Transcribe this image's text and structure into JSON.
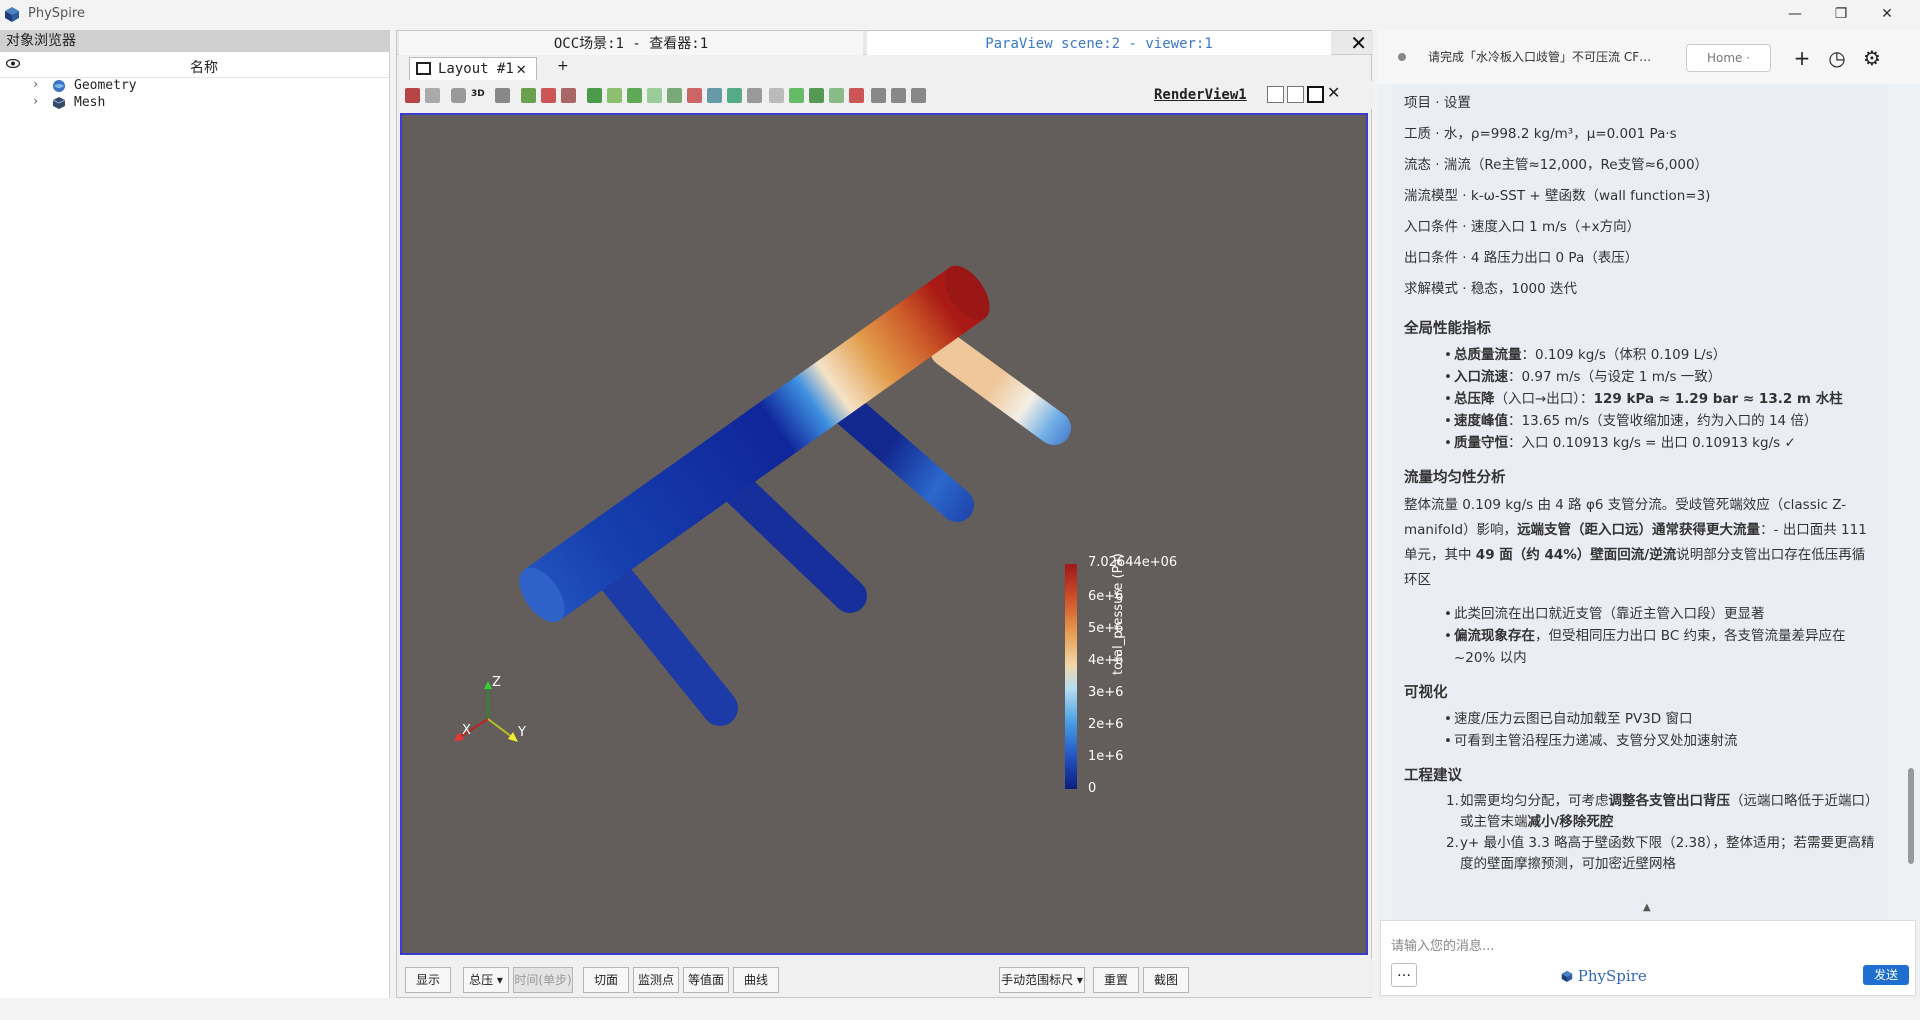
{
  "app": {
    "title": "PhySpire"
  },
  "window": {
    "minimize": "—",
    "restore": "❐",
    "close": "✕"
  },
  "object_browser": {
    "title": "对象浏览器",
    "column_name": "名称",
    "items": [
      {
        "label": "Geometry",
        "expander": "›"
      },
      {
        "label": "Mesh",
        "expander": "›"
      }
    ]
  },
  "viewer_tabs": {
    "occ": "OCC场景:1 - 查看器:1",
    "paraview": "ParaView scene:2 - viewer:1",
    "close": "✕"
  },
  "layout": {
    "tab_label": "Layout #1",
    "close": "✕",
    "add": "+"
  },
  "toolbar": {
    "three_d": "3D",
    "render_view": "RenderView1"
  },
  "legend": {
    "title": "total_pressure (Pa)",
    "max_label": "7.02644e+06",
    "ticks": [
      "6e+6",
      "5e+6",
      "4e+6",
      "3e+6",
      "2e+6",
      "1e+6",
      "0"
    ]
  },
  "axes": {
    "z": "Z",
    "x": "X",
    "y": "Y"
  },
  "bottom_bar": {
    "display": "显示",
    "variable": "总压",
    "time_step": "时间(单步)",
    "slice": "切面",
    "probe": "监测点",
    "contour": "等值面",
    "curve": "曲线",
    "range_mode": "手动范围标尺",
    "reset": "重置",
    "screenshot": "截图"
  },
  "chat": {
    "session_title": "请完成「水冷板入口歧管」不可压流 CF…",
    "home": "Home",
    "new": "+",
    "history": "◷",
    "settings": "⚙",
    "input_placeholder": "请输入您的消息...",
    "more": "…",
    "brand": "PhySpire",
    "send": "发送",
    "report": {
      "setup": [
        "项目 · 设置",
        "工质 · 水，ρ=998.2 kg/m³，μ=0.001 Pa·s",
        "流态 · 湍流（Re主管≈12,000，Re支管≈6,000）",
        "湍流模型 · k-ω-SST + 壁函数（wall function=3)",
        "入口条件 · 速度入口 1 m/s（+x方向）",
        "出口条件 · 4 路压力出口 0 Pa（表压）",
        "求解模式 · 稳态，1000 迭代"
      ],
      "h_performance": "全局性能指标",
      "performance": [
        {
          "b": "总质量流量",
          "t": "：0.109 kg/s（体积 0.109 L/s）"
        },
        {
          "b": "入口流速",
          "t": "：0.97 m/s（与设定 1 m/s 一致）"
        },
        {
          "b": "总压降",
          "t": "（入口→出口）：",
          "b2": "129 kPa ≈ 1.29 bar ≈ 13.2 m 水柱"
        },
        {
          "b": "速度峰值",
          "t": "：13.65 m/s（支管收缩加速，约为入口的 14 倍）"
        },
        {
          "b": "质量守恒",
          "t": "：入口 0.10913 kg/s = 出口 0.10913 kg/s ✓"
        }
      ],
      "h_uniformity": "流量均匀性分析",
      "uniformity_p1a": "整体流量 0.109 kg/s 由 4 路 φ6 支管分流。受歧管死端效应（classic Z-manifold）影响，",
      "uniformity_p1b": "远端支管（距入口远）通常获得更大流量",
      "uniformity_p1c": "：- 出口面共 111 单元，其中 ",
      "uniformity_p1d": "49 面（约 44%）壁面回流/逆流",
      "uniformity_p1e": "说明部分支管出口存在低压再循环区",
      "uniformity_b1": "此类回流在出口就近支管（靠近主管入口段）更显著",
      "uniformity_b2a": "偏流现象存在",
      "uniformity_b2b": "，但受相同压力出口 BC 约束，各支管流量差异应在 ~20% 以内",
      "h_visual": "可视化",
      "visual": [
        "速度/压力云图已自动加载至 PV3D 窗口",
        "可看到主管沿程压力递减、支管分叉处加速射流"
      ],
      "h_advice": "工程建议",
      "advice1a": "如需更均匀分配，可考虑",
      "advice1b": "调整各支管出口背压",
      "advice1c": "（远端口略低于近端口）或主管末端",
      "advice1d": "减小/移除死腔",
      "advice2": "y+ 最小值 3.3 略高于壁函数下限（2.38），整体适用；若需要更高精度的壁面摩擦预测，可加密近壁网格"
    }
  },
  "colors": {
    "accent": "#1f6fd1",
    "viewport_bg": "#635e5c",
    "selection_border": "#3b3bd1"
  }
}
